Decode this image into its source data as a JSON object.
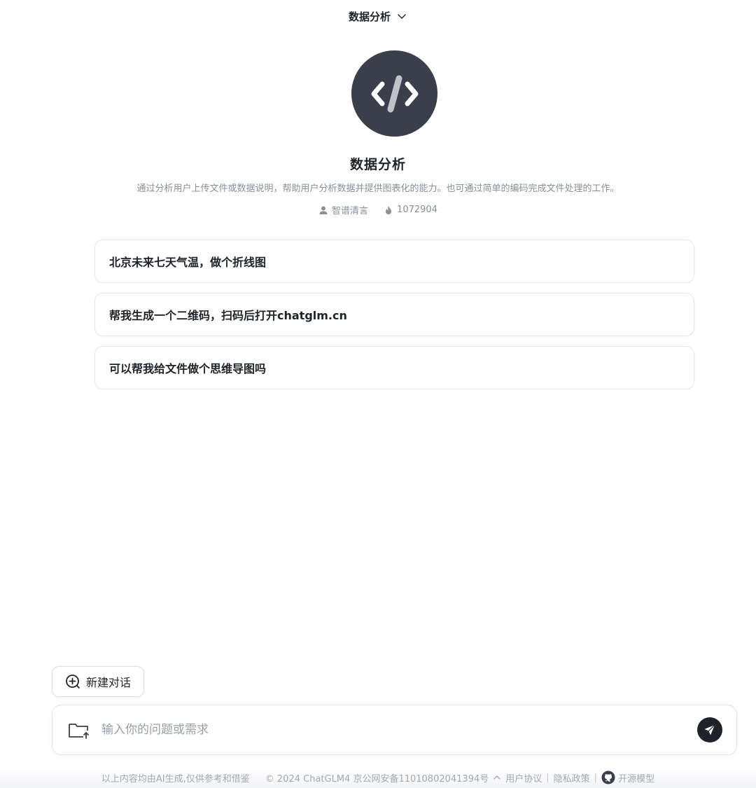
{
  "header": {
    "title": "数据分析"
  },
  "agent": {
    "name": "数据分析",
    "description": "通过分析用户上传文件或数据说明，帮助用户分析数据并提供图表化的能力。也可通过简单的编码完成文件处理的工作。",
    "author": "智谱清言",
    "usage_count": "1072904"
  },
  "suggestions": [
    "北京未来七天气温，做个折线图",
    "帮我生成一个二维码，扫码后打开chatglm.cn",
    "可以帮我给文件做个思维导图吗"
  ],
  "new_chat_label": "新建对话",
  "input": {
    "placeholder": "输入你的问题或需求",
    "value": ""
  },
  "footer": {
    "disclaimer": "以上内容均由AI生成,仅供参考和借鉴",
    "copyright": "© 2024 ChatGLM4 京公网安备11010802041394号",
    "user_agreement": "用户协议",
    "privacy": "隐私政策",
    "open_source": "开源模型"
  },
  "colors": {
    "avatar_bg": "#3a3f4b",
    "send_bg": "#1f2329",
    "muted_text": "#8a8f99"
  }
}
